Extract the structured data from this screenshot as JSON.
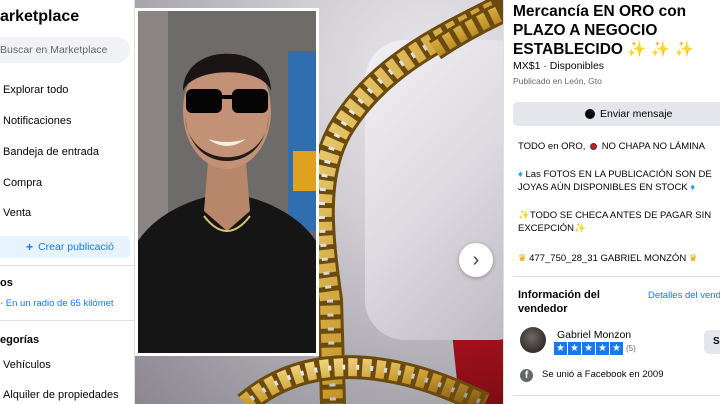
{
  "sidebar": {
    "title": "arketplace",
    "search_placeholder": "Buscar en Marketplace",
    "items": [
      {
        "label": "Explorar todo",
        "icon": "store-icon"
      },
      {
        "label": "Notificaciones",
        "icon": "bell-icon"
      },
      {
        "label": "Bandeja de entrada",
        "icon": "inbox-icon"
      },
      {
        "label": "Compra",
        "icon": "bag-icon"
      },
      {
        "label": "Venta",
        "icon": "tag-icon"
      }
    ],
    "create_listing": "Crear publicació",
    "location_heading": "os",
    "radius": "· En un radio de 65 kilómet",
    "categories_heading": "egorías",
    "category_items": [
      {
        "label": "Vehículos"
      },
      {
        "label": "Alquiler de propiedades"
      }
    ]
  },
  "listing": {
    "title_line1": "Mercancía EN ORO con",
    "title_line2": "PLAZO A NEGOCIO",
    "title_line3": "ESTABLECIDO",
    "title_sparkles": "✨ ✨ ✨",
    "price": "MX$1 · Disponibles",
    "location": "Publicado en León, Gto",
    "message_button": "Enviar mensaje",
    "desc_line1_a": "TODO en ORO,",
    "desc_line1_b": "NO CHAPA NO LÁMINA",
    "desc_line2_a": "Las FOTOS EN LA PUBLICACIÓN SON DE",
    "desc_line2_b": "JOYAS AÚN DISPONIBLES EN STOCK",
    "desc_line3_a": "TODO SE CHECA ANTES DE PAGAR SIN",
    "desc_line3_b": "EXCEPCIÓN",
    "desc_phone": "477_750_28_31 GABRIEL MONZÓN",
    "seller_heading": "Información del vendedor",
    "seller_details_link": "Detalles del vend",
    "seller_name": "Gabriel Monzon",
    "seller_rating_count": "(5)",
    "seller_rating_stars": 5,
    "follow_button": "Se",
    "joined": "Se unió a Facebook en 2009"
  },
  "colors": {
    "accent_blue": "#1877f2",
    "sparkle_gold": "#f5b800",
    "gem_blue": "#2aa4e8"
  }
}
